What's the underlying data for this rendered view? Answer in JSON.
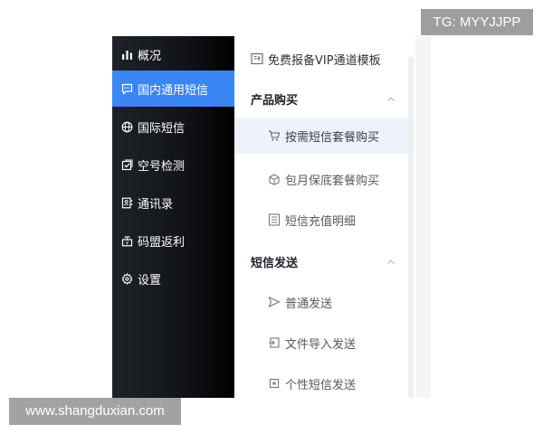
{
  "watermarks": {
    "tg": "TG: MYYJJPP",
    "site": "www.shangduxian.com"
  },
  "sidebar": {
    "items": [
      {
        "label": "概况",
        "icon": "bar-chart-icon"
      },
      {
        "label": "国内通用短信",
        "icon": "message-icon",
        "active": true
      },
      {
        "label": "国际短信",
        "icon": "globe-icon"
      },
      {
        "label": "空号检测",
        "icon": "check-square-icon"
      },
      {
        "label": "通讯录",
        "icon": "contacts-icon"
      },
      {
        "label": "码盟返利",
        "icon": "gift-icon"
      },
      {
        "label": "设置",
        "icon": "gear-icon"
      }
    ],
    "active_color": "#3a86f5"
  },
  "panel": {
    "top_link": {
      "label": "免费报备VIP通道模板",
      "icon": "template-icon"
    },
    "groups": [
      {
        "title": "产品购买",
        "items": [
          {
            "label": "按需短信套餐购买",
            "icon": "cart-icon",
            "selected": true
          },
          {
            "label": "包月保底套餐购买",
            "icon": "package-icon"
          },
          {
            "label": "短信充值明细",
            "icon": "list-icon"
          }
        ]
      },
      {
        "title": "短信发送",
        "items": [
          {
            "label": "普通发送",
            "icon": "send-icon"
          },
          {
            "label": "文件导入发送",
            "icon": "import-icon"
          },
          {
            "label": "个性短信发送",
            "icon": "personal-icon"
          }
        ]
      }
    ]
  }
}
